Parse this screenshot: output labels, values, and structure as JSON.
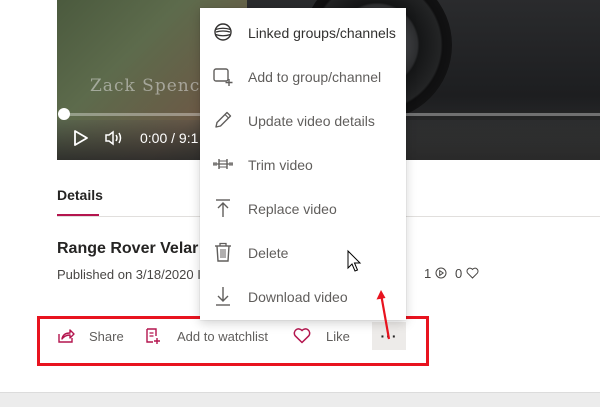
{
  "video": {
    "watermark": "Zack Spence",
    "time": "0:00  /  9:1",
    "progress_fraction": 0.0
  },
  "details": {
    "tab_label": "Details",
    "title": "Range Rover Velar",
    "published": "Published on 3/18/2020 I",
    "views_count": "1",
    "likes_count": "0"
  },
  "actions": {
    "share_label": "Share",
    "watchlist_label": "Add to watchlist",
    "like_label": "Like",
    "more_label": "···"
  },
  "menu": {
    "items": [
      {
        "label": "Linked groups/channels",
        "icon": "globe-icon"
      },
      {
        "label": "Add to group/channel",
        "icon": "add-to-group-icon"
      },
      {
        "label": "Update video details",
        "icon": "pencil-icon"
      },
      {
        "label": "Trim video",
        "icon": "trim-icon"
      },
      {
        "label": "Replace video",
        "icon": "upload-icon"
      },
      {
        "label": "Delete",
        "icon": "trash-icon"
      },
      {
        "label": "Download video",
        "icon": "download-icon"
      }
    ]
  },
  "colors": {
    "accent": "#b4154e",
    "annotation_red": "#e8131f"
  }
}
